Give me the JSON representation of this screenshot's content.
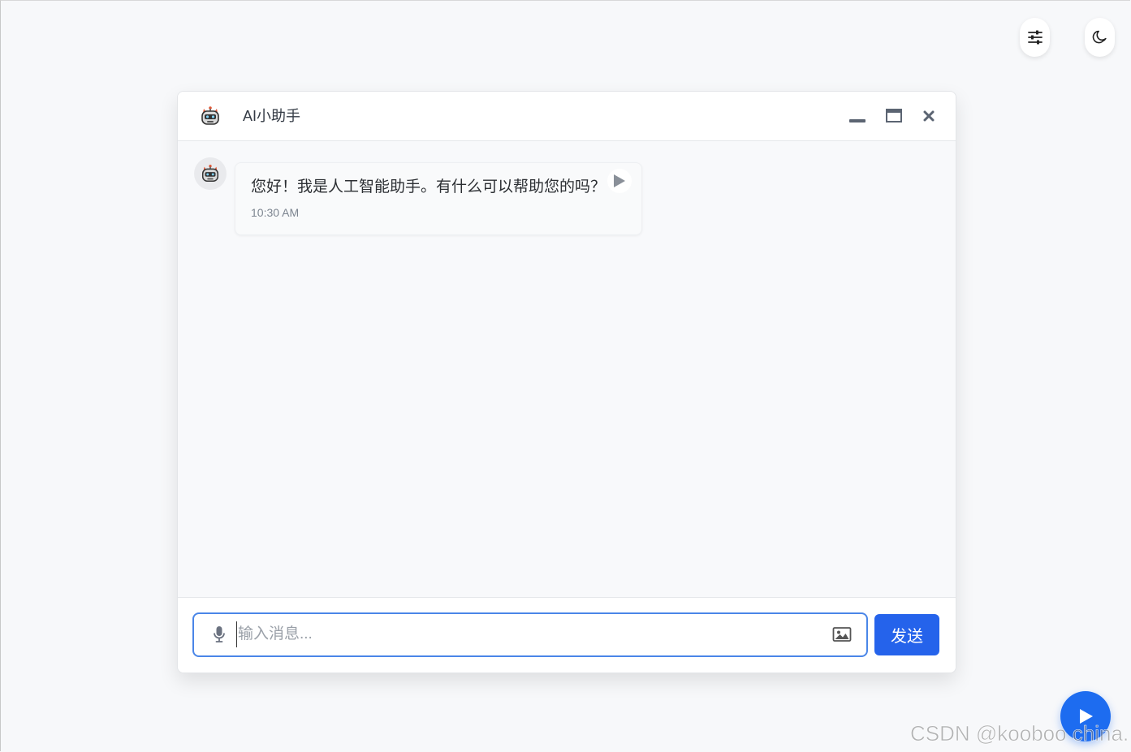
{
  "app": {
    "title": "AI小助手"
  },
  "toolbar": {
    "settings_icon": "sliders-icon",
    "theme_icon": "moon-icon"
  },
  "window_controls": {
    "minimize_icon": "minimize-icon",
    "maximize_icon": "maximize-icon",
    "close_icon": "close-icon"
  },
  "messages": [
    {
      "sender": "assistant",
      "avatar_icon": "robot-icon",
      "text": "您好！我是人工智能助手。有什么可以帮助您的吗？",
      "time": "10:30 AM",
      "play_icon": "play-icon"
    }
  ],
  "composer": {
    "placeholder": "输入消息...",
    "value": "",
    "mic_icon": "microphone-icon",
    "image_icon": "image-icon",
    "send_label": "发送"
  },
  "fab": {
    "icon": "play-icon"
  },
  "watermark": "CSDN @kooboo china.",
  "colors": {
    "accent": "#2563eb",
    "input_focus_border": "#4a86e8",
    "background": "#f7f8fa"
  }
}
